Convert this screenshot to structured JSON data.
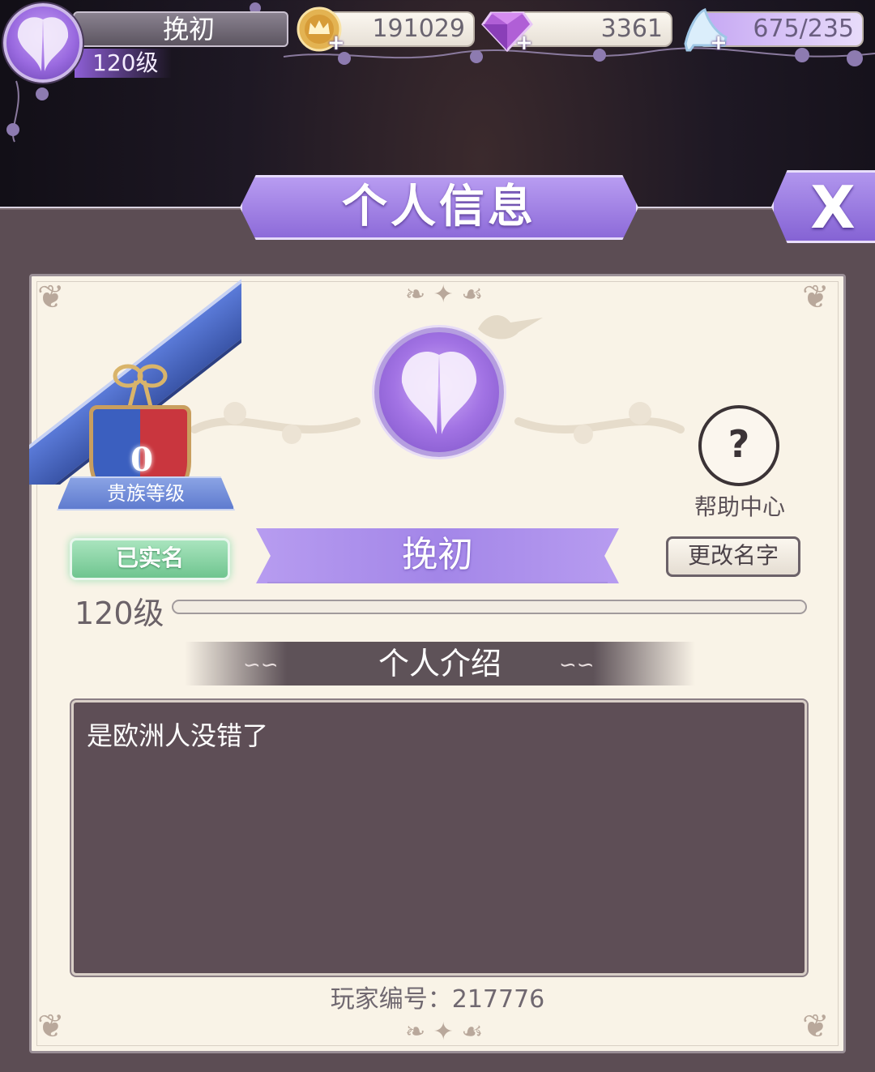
{
  "hud": {
    "player_name": "挽初",
    "level": "120级",
    "gold": "191029",
    "diamonds": "3361",
    "stamina": "675/235",
    "plus": "+"
  },
  "title": "个人信息",
  "close_label": "X",
  "profile": {
    "noble_level": "0",
    "noble_label": "贵族等级",
    "verified": "已实名",
    "name": "挽初",
    "rename": "更改名字",
    "help": "帮助中心",
    "help_glyph": "?",
    "level": "120级",
    "exp_fraction": 0.0,
    "intro_title": "个人介绍",
    "intro_text": "是欧洲人没错了",
    "player_id": "玩家编号：217776"
  },
  "colors": {
    "accent_purple": "#9b78e2",
    "panel": "#5c4d54",
    "card": "#f9f3e7",
    "verified_green": "#6fc58f"
  },
  "icons": [
    "wings-avatar-icon",
    "gold-crown-coin-icon",
    "purple-diamond-icon",
    "glass-slipper-icon",
    "help-book-icon",
    "close-icon"
  ]
}
